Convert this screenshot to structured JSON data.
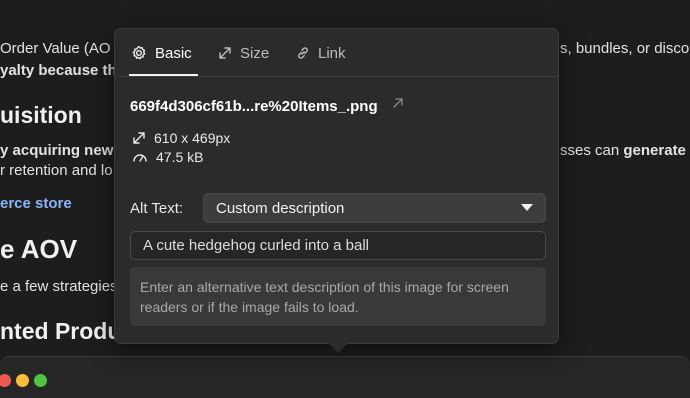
{
  "background": {
    "line1": "Order Value (AO",
    "line1_right": "s, bundles, or disco",
    "line2": "yalty because th",
    "heading1": "uisition",
    "line3_bold": "y acquiring new",
    "line3_right_normal": "sses can ",
    "line3_right_bold": "generate",
    "line4": "r retention and lo",
    "link": "erce store",
    "heading2": "e AOV",
    "line5": "e a few strategies",
    "heading3": "nted Produ"
  },
  "popover": {
    "tabs": [
      {
        "label": "Basic",
        "icon": "gear-icon",
        "active": true
      },
      {
        "label": "Size",
        "icon": "resize-icon",
        "active": false
      },
      {
        "label": "Link",
        "icon": "link-icon",
        "active": false
      }
    ],
    "filename": "669f4d306cf61b...re%20Items_.png",
    "dimensions": "610 x 469px",
    "filesize": "47.5 kB",
    "alt_label": "Alt Text:",
    "alt_mode": "Custom description",
    "alt_value": "A cute hedgehog curled into a ball",
    "help_text": "Enter an alternative text description of this image for screen readers or if the image fails to load."
  },
  "colors": {
    "background": "#1d1d1d",
    "panel": "#2b2b2b",
    "accent_link": "#8ab4f8",
    "traffic_red": "#ee5a52",
    "traffic_yellow": "#f6bd3b",
    "traffic_green": "#4fc441"
  }
}
